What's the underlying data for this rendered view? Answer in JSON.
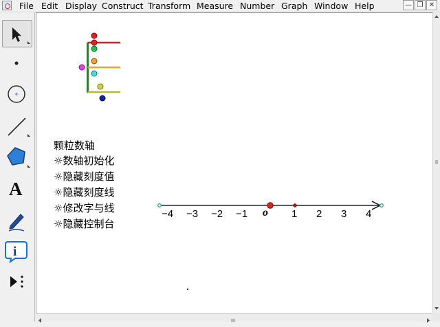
{
  "menubar": {
    "items": [
      "File",
      "Edit",
      "Display",
      "Construct",
      "Transform",
      "Measure",
      "Number",
      "Graph",
      "Window",
      "Help"
    ],
    "window_buttons": [
      "—",
      "❐",
      "✕"
    ]
  },
  "toolbox": {
    "tools": [
      "arrow-select-tool",
      "point-tool",
      "compass-tool",
      "straightedge-tool",
      "polygon-tool",
      "text-tool",
      "marker-tool",
      "information-tool",
      "custom-tool"
    ],
    "text_tool_glyph": "A",
    "info_tool_glyph": "i"
  },
  "canvas": {
    "title": "颗粒数轴",
    "buttons": [
      {
        "label": "☼数轴初始化"
      },
      {
        "label": "☼隐藏刻度值"
      },
      {
        "label": "☼隐藏刻度线"
      },
      {
        "label": "☼修改字与线"
      },
      {
        "label": "☼隐藏控制台"
      }
    ],
    "number_line": {
      "origin_label": "o",
      "ticks": [
        "−4",
        "−3",
        "−2",
        "−1",
        "1",
        "2",
        "3",
        "4"
      ],
      "origin_color": "#d9241c",
      "unit_point_color": "#b02020",
      "endpoint_color": "#2aa6a0"
    },
    "control_panel": {
      "colors": {
        "red": "#e02020",
        "green": "#22b14c",
        "orange": "#f0a030",
        "magenta": "#e040e0",
        "cyan": "#40d0d0",
        "olive": "#b0b020",
        "yellow": "#d8d040",
        "blue": "#1020a0",
        "dark_green": "#2e7d32"
      }
    }
  }
}
